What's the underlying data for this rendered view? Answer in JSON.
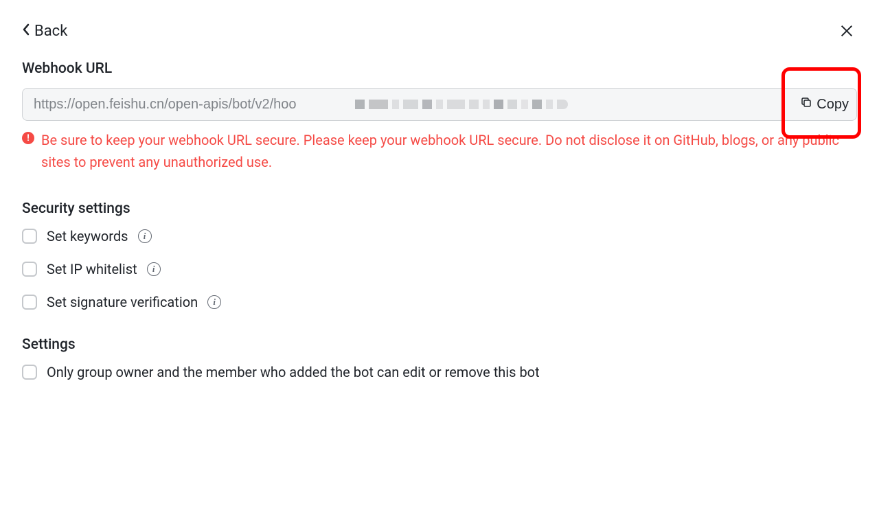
{
  "header": {
    "back_label": "Back"
  },
  "webhook": {
    "label": "Webhook URL",
    "url_value": "https://open.feishu.cn/open-apis/bot/v2/hoo",
    "copy_label": "Copy",
    "warning_text": "Be sure to keep your webhook URL secure. Please keep your webhook URL secure. Do not disclose it on GitHub, blogs, or any public sites to prevent any unauthorized use."
  },
  "security": {
    "label": "Security settings",
    "options": {
      "keywords": "Set keywords",
      "ip_whitelist": "Set IP whitelist",
      "signature": "Set signature verification"
    }
  },
  "settings": {
    "label": "Settings",
    "owner_only": "Only group owner and the member who added the bot can edit or remove this bot"
  }
}
